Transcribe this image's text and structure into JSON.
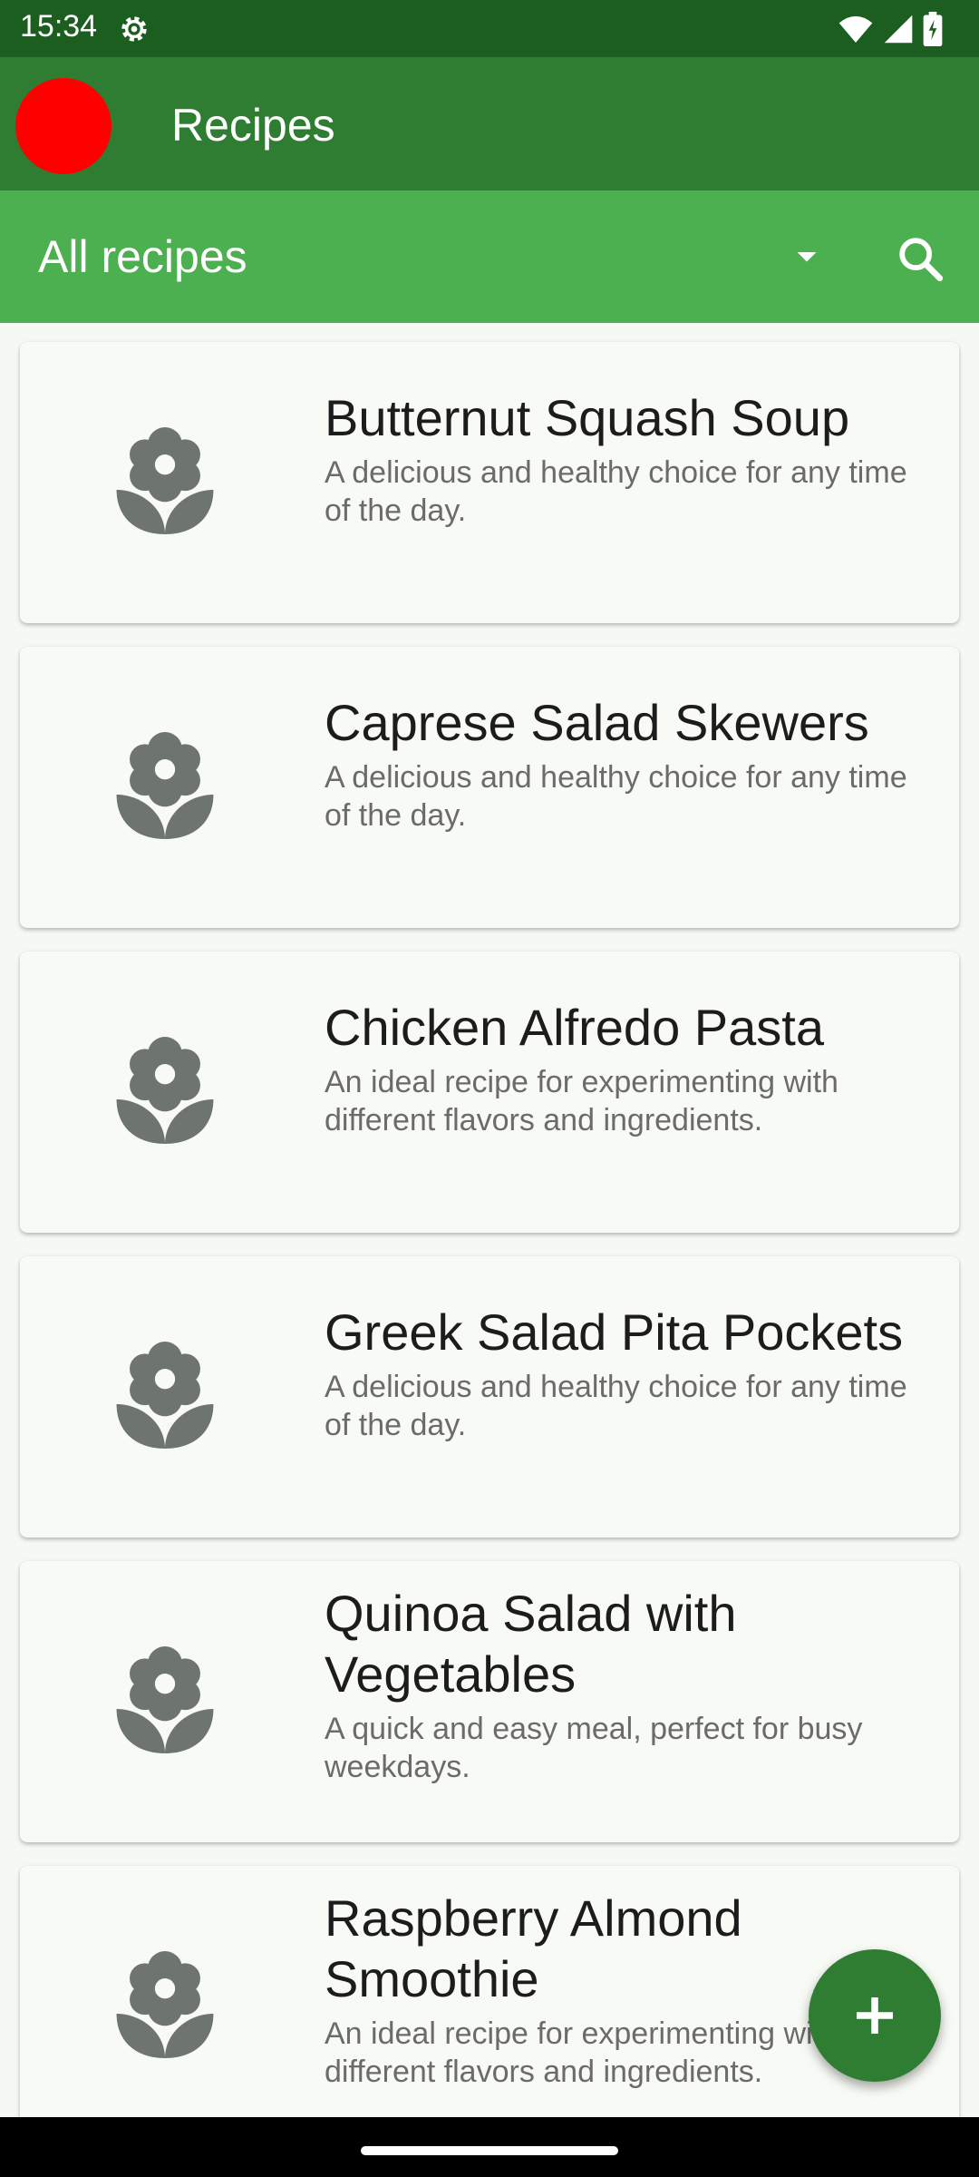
{
  "status_bar": {
    "time": "15:34"
  },
  "app_bar": {
    "title": "Recipes"
  },
  "filter_bar": {
    "selected": "All recipes"
  },
  "recipes": [
    {
      "title": "Butternut Squash Soup",
      "description": "A delicious and healthy choice for any time of the day."
    },
    {
      "title": "Caprese Salad Skewers",
      "description": "A delicious and healthy choice for any time of the day."
    },
    {
      "title": "Chicken Alfredo Pasta",
      "description": "An ideal recipe for experimenting with different flavors and ingredients."
    },
    {
      "title": "Greek Salad Pita Pockets",
      "description": "A delicious and healthy choice for any time of the day."
    },
    {
      "title": "Quinoa Salad with Vegetables",
      "description": "A quick and easy meal, perfect for busy weekdays."
    },
    {
      "title": "Raspberry Almond Smoothie",
      "description": "An ideal recipe for experimenting with different flavors and ingredients."
    }
  ],
  "colors": {
    "status_bar": "#1b5e20",
    "app_bar": "#2e7d32",
    "filter_bar": "#4caf50",
    "avatar": "#ff0000",
    "fab": "#2e7d32",
    "icon_gray": "#6e7470"
  },
  "icons": {
    "status": [
      "gear-icon",
      "wifi-icon",
      "signal-icon",
      "battery-icon"
    ],
    "filter": [
      "dropdown-arrow-icon",
      "search-icon"
    ],
    "card": "flower-icon",
    "fab": "plus-icon"
  }
}
